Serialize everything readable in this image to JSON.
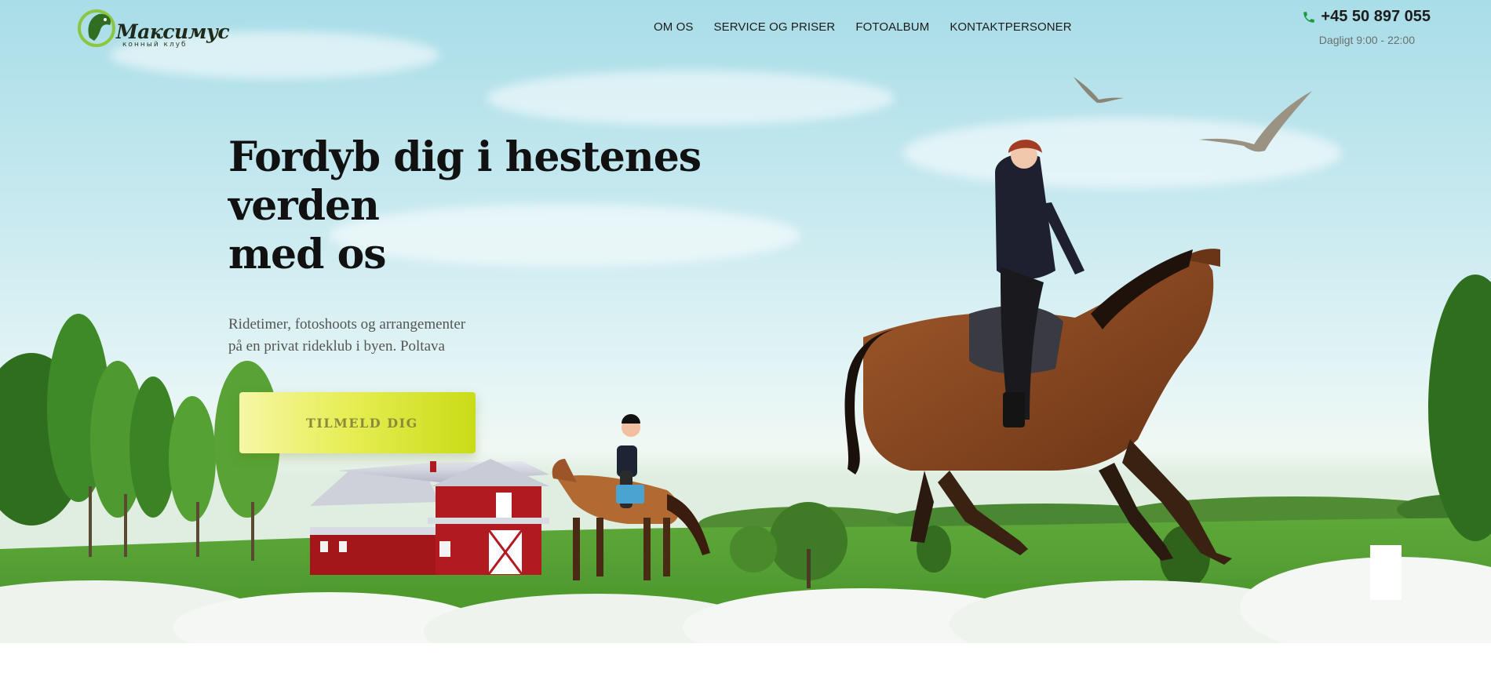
{
  "brand": {
    "name": "Максимус",
    "tagline": "конный клуб"
  },
  "nav": {
    "items": [
      {
        "label": "OM OS"
      },
      {
        "label": "SERVICE OG PRISER"
      },
      {
        "label": "FOTOALBUM"
      },
      {
        "label": "KONTAKTPERSONER"
      }
    ]
  },
  "contact": {
    "phone": "+45 50 897 055",
    "hours": "Dagligt 9:00 - 22:00",
    "icon": "phone-icon"
  },
  "hero": {
    "title_lines": [
      "Fordyb dig i hestenes",
      "verden",
      "med os"
    ],
    "subtitle_lines": [
      "Ridetimer, fotoshoots og arrangementer",
      "på en privat rideklub i byen. Poltava"
    ],
    "cta_label": "TILMELD DIG"
  },
  "colors": {
    "accent": "#d6e42a",
    "phone_icon": "#1a9a3c",
    "text_dark": "#111111",
    "text_muted": "#555555"
  }
}
